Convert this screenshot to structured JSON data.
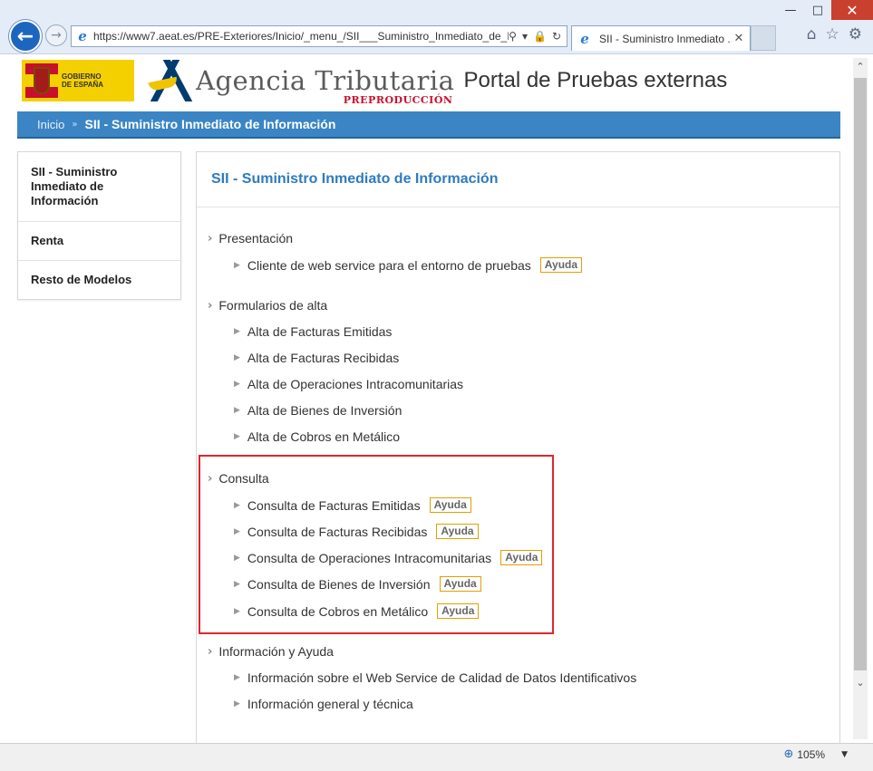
{
  "browser": {
    "address": "https://www7.aeat.es/PRE-Exteriores/Inicio/_menu_/SII___Suministro_Inmediato_de_Ir",
    "tab_title": "SII - Suministro Inmediato ...",
    "zoom": "105%"
  },
  "header": {
    "gobierno_line1": "GOBIERNO",
    "gobierno_line2": "DE ESPAÑA",
    "agency_name": "Agencia Tributaria",
    "preproduccion": "PREPRODUCCIÓN",
    "portal_title": "Portal de Pruebas externas"
  },
  "breadcrumb": {
    "home": "Inicio",
    "current": "SII - Suministro Inmediato de Información"
  },
  "sidebar": {
    "items": [
      {
        "label": "SII - Suministro Inmediato de Información"
      },
      {
        "label": "Renta"
      },
      {
        "label": "Resto de Modelos"
      }
    ]
  },
  "main": {
    "title": "SII - Suministro Inmediato de Información",
    "help_label": "Ayuda",
    "sections": [
      {
        "label": "Presentación",
        "items": [
          {
            "label": "Cliente de web service para el entorno de pruebas"
          }
        ]
      },
      {
        "label": "Formularios de alta",
        "items": [
          {
            "label": "Alta de Facturas Emitidas"
          },
          {
            "label": "Alta de Facturas Recibidas"
          },
          {
            "label": "Alta de Operaciones Intracomunitarias"
          },
          {
            "label": "Alta de Bienes de Inversión"
          },
          {
            "label": "Alta de Cobros en Metálico"
          }
        ]
      },
      {
        "label": "Consulta",
        "items": [
          {
            "label": "Consulta de Facturas Emitidas"
          },
          {
            "label": "Consulta de Facturas Recibidas"
          },
          {
            "label": "Consulta de Operaciones Intracomunitarias"
          },
          {
            "label": "Consulta de Bienes de Inversión"
          },
          {
            "label": "Consulta de Cobros en Metálico"
          }
        ]
      },
      {
        "label": "Información y Ayuda",
        "items": [
          {
            "label": "Información sobre el Web Service de Calidad de Datos Identificativos"
          },
          {
            "label": "Información general y técnica"
          }
        ]
      }
    ]
  },
  "colors": {
    "accent_blue": "#3b85c5",
    "title_blue": "#2e7bbf",
    "highlight_red": "#e0262c",
    "help_border": "#e0a000"
  }
}
